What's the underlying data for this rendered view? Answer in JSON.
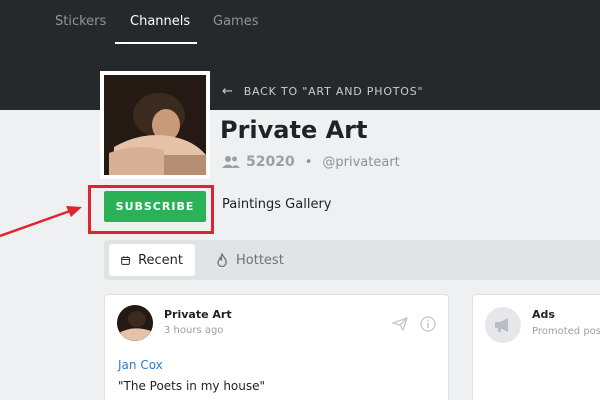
{
  "nav": {
    "items": [
      {
        "label": "Stickers",
        "active": false
      },
      {
        "label": "Channels",
        "active": true
      },
      {
        "label": "Games",
        "active": false
      }
    ]
  },
  "back_link": {
    "label": "BACK TO \"ART AND PHOTOS\""
  },
  "channel": {
    "title": "Private Art",
    "subscribers": "52020",
    "handle": "@privateart",
    "description": "Paintings Gallery",
    "subscribe_label": "SUBSCRIBE"
  },
  "tabs": [
    {
      "label": "Recent",
      "icon": "calendar-icon",
      "active": true
    },
    {
      "label": "Hottest",
      "icon": "flame-icon",
      "active": false
    }
  ],
  "post": {
    "author": "Private Art",
    "time": "3 hours ago",
    "link_text": "Jan Cox",
    "text": "\"The Poets in my house\""
  },
  "ads": {
    "title": "Ads",
    "subtitle": "Promoted posts"
  },
  "colors": {
    "header_bg": "#26292c",
    "subscribe_green": "#2bb257",
    "highlight_red": "#e0232f",
    "link_blue": "#2d7dd2"
  }
}
